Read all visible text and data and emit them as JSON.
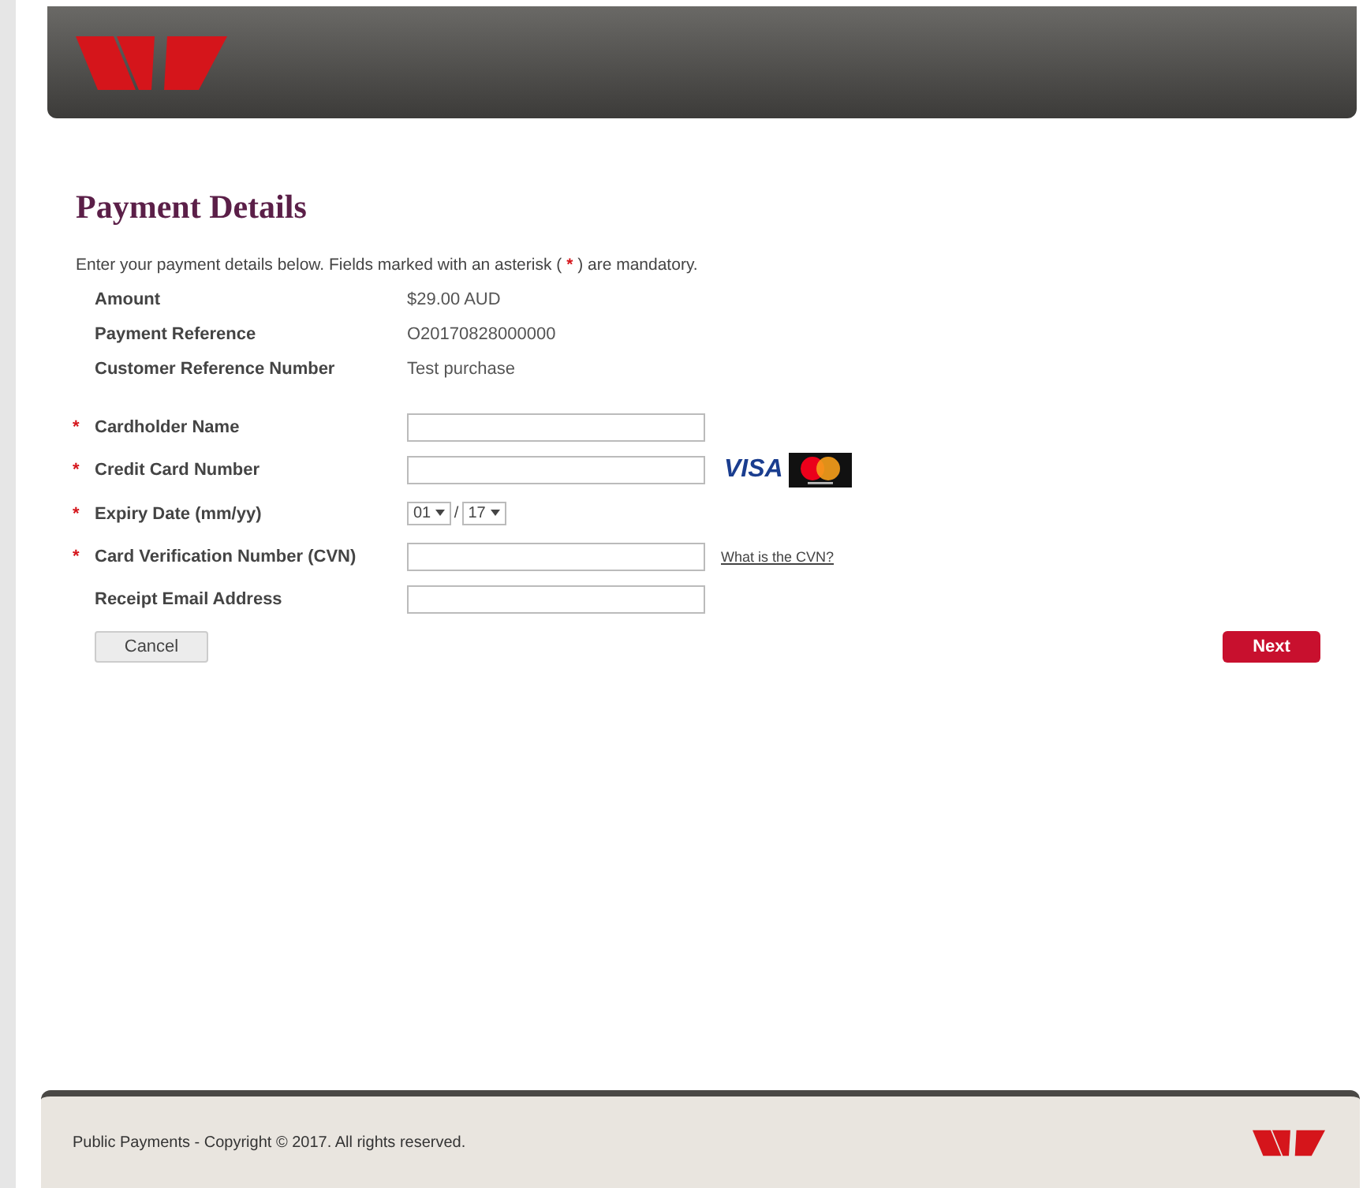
{
  "page": {
    "title": "Payment Details",
    "intro": {
      "before": "Enter your payment details below. Fields marked with an asterisk (",
      "mark": "*",
      "after": ") are mandatory."
    }
  },
  "summary": [
    {
      "label": "Amount",
      "value": "$29.00 AUD"
    },
    {
      "label": "Payment Reference",
      "value": "O20170828000000"
    },
    {
      "label": "Customer Reference Number",
      "value": "Test purchase"
    }
  ],
  "fields": [
    {
      "kind": "text",
      "label": "Cardholder Name",
      "required": true
    },
    {
      "kind": "text",
      "label": "Credit Card Number",
      "required": true,
      "card_logo_text": "VISA"
    },
    {
      "kind": "expiry",
      "label": "Expiry Date (mm/yy)",
      "required": true,
      "month": "01",
      "year": "17",
      "separator": "/"
    },
    {
      "kind": "text",
      "label": "Card Verification Number (CVN)",
      "required": true,
      "link": "What is the CVN?"
    },
    {
      "kind": "text",
      "label": "Receipt Email Address",
      "required": false
    }
  ],
  "required_mark": "*",
  "buttons": {
    "cancel": "Cancel",
    "next": "Next"
  },
  "footer": {
    "text": "Public Payments - Copyright © 2017. All rights reserved."
  }
}
